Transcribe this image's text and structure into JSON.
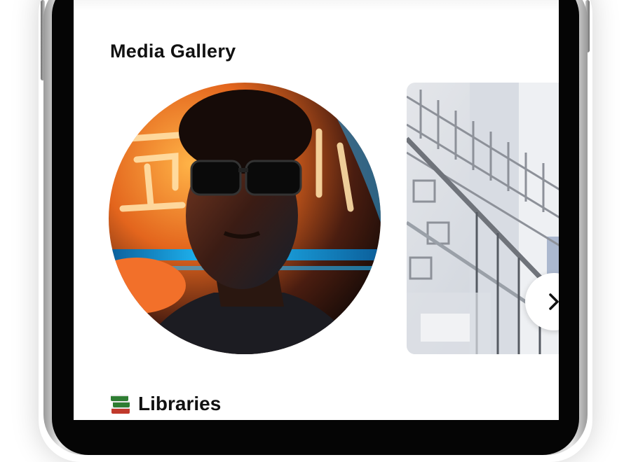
{
  "gallery": {
    "title": "Media Gallery",
    "images": [
      {
        "name": "portrait-photo",
        "shape": "circle"
      },
      {
        "name": "staircase-photo",
        "shape": "rounded-rect"
      }
    ],
    "next_icon": "chevron-right-icon"
  },
  "libraries": {
    "icon": "books-icon",
    "title": "Libraries"
  },
  "colors": {
    "frame": "#050505",
    "screen": "#ffffff",
    "text": "#111111",
    "neon_orange": "#ff8a1c",
    "neon_blue": "#1fb8ff"
  }
}
